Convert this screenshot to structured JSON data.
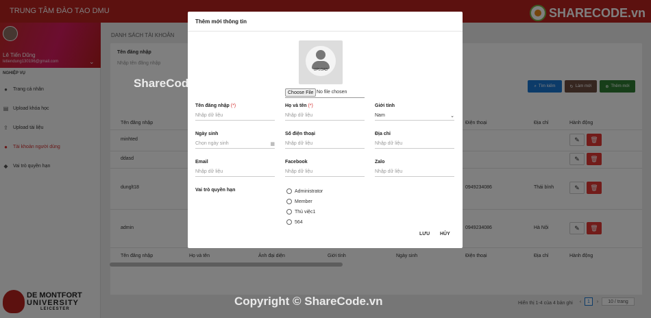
{
  "app": {
    "title": "TRUNG TÂM ĐÀO TẠO DMU",
    "watermark_logo": "SHARECODE.vn"
  },
  "sidebar": {
    "user": {
      "name": "Lê Tiến Dũng",
      "email": "letiendung130196@gmail.com"
    },
    "section": "NGHIỆP VỤ",
    "items": [
      {
        "label": "Trang cá nhân",
        "icon": "user-icon"
      },
      {
        "label": "Upload khóa học",
        "icon": "course-icon"
      },
      {
        "label": "Upload tài liệu",
        "icon": "upload-icon"
      },
      {
        "label": "Tài khoản người dùng",
        "icon": "users-icon",
        "active": true
      },
      {
        "label": "Vai trò quyền hạn",
        "icon": "shield-icon"
      }
    ],
    "logo": {
      "line1": "DE MONTFORT",
      "line2": "UNIVERSITY",
      "line3": "LEICESTER"
    }
  },
  "page": {
    "title": "DANH SÁCH TÀI KHOẢN",
    "filter": {
      "label": "Tên đăng nhập",
      "placeholder": "Nhập tên đăng nhập"
    },
    "buttons": {
      "search": "Tìm kiếm",
      "reset": "Làm mới",
      "add": "Thêm mới"
    },
    "colors": {
      "search": "#1976d2",
      "reset": "#6d4c41",
      "add": "#2e7d32",
      "delete": "#e53935"
    }
  },
  "table": {
    "columns": [
      "Tên đăng nhập",
      "Họ và tên",
      "Ảnh đại diện",
      "Giới tính",
      "Ngày sinh",
      "Điện thoại",
      "Địa chỉ",
      "Hành động"
    ],
    "rows": [
      {
        "username": "minhted",
        "phone": "",
        "address": ""
      },
      {
        "username": "ddasd",
        "phone": "",
        "address": ""
      },
      {
        "username": "dunglt18",
        "phone": "0949234086",
        "address": "Thái bình"
      },
      {
        "username": "admin",
        "phone": "0949234086",
        "address": "Hà Nội"
      }
    ],
    "pagination": {
      "summary": "Hiển thị 1-4 của 4 bản ghi",
      "prev": "‹",
      "current": "1",
      "next": "›",
      "page_size": "10 / trang"
    }
  },
  "modal": {
    "title": "Thêm mới thông tin",
    "upload_label": "UPLOAD",
    "file_button": "Choose File",
    "file_status": "No file chosen",
    "fields": {
      "username": {
        "label": "Tên đăng nhập",
        "required": "(*)",
        "placeholder": "Nhập dữ liệu"
      },
      "fullname": {
        "label": "Họ và tên",
        "required": "(*)",
        "placeholder": "Nhập dữ liệu"
      },
      "gender": {
        "label": "Giới tính",
        "value": "Nam"
      },
      "birthday": {
        "label": "Ngày sinh",
        "placeholder": "Chọn ngày sinh"
      },
      "phone": {
        "label": "Số điện thoại",
        "placeholder": "Nhập dữ liệu"
      },
      "address": {
        "label": "Địa chỉ",
        "placeholder": "Nhập dữ liệu"
      },
      "email": {
        "label": "Email",
        "placeholder": "Nhập dữ liệu"
      },
      "facebook": {
        "label": "Facebook",
        "placeholder": "Nhập dữ liệu"
      },
      "zalo": {
        "label": "Zalo",
        "placeholder": "Nhập dữ liệu"
      }
    },
    "role_label": "Vai trò quyền hạn",
    "roles": [
      "Administrator",
      "Member",
      "Thủ việc1",
      "564"
    ],
    "save": "LƯU",
    "cancel": "HỦY"
  },
  "watermarks": {
    "center": "ShareCode.vn",
    "bottom": "Copyright © ShareCode.vn"
  }
}
